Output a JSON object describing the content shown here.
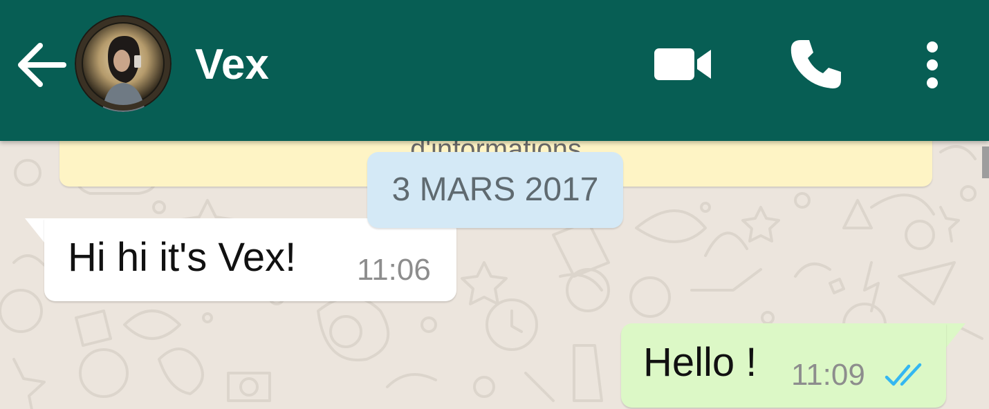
{
  "header": {
    "contact_name": "Vex",
    "icons": {
      "back": "arrow-left-icon",
      "video": "video-camera-icon",
      "call": "phone-icon",
      "menu": "more-vertical-icon"
    },
    "color": "#075E54"
  },
  "notice": {
    "text": "d'informations",
    "color": "#FEF4C5"
  },
  "date_chip": {
    "text": "3 MARS 2017",
    "color": "#D4E9F6"
  },
  "messages": [
    {
      "direction": "incoming",
      "text": "Hi hi it's Vex!",
      "time": "11:06",
      "color": "#FFFFFF"
    },
    {
      "direction": "outgoing",
      "text": "Hello !",
      "time": "11:09",
      "status_icon": "double-check-read-icon",
      "status_color": "#34B7F1",
      "color": "#DCF8C6"
    }
  ],
  "wallpaper_color": "#ECE5DD"
}
